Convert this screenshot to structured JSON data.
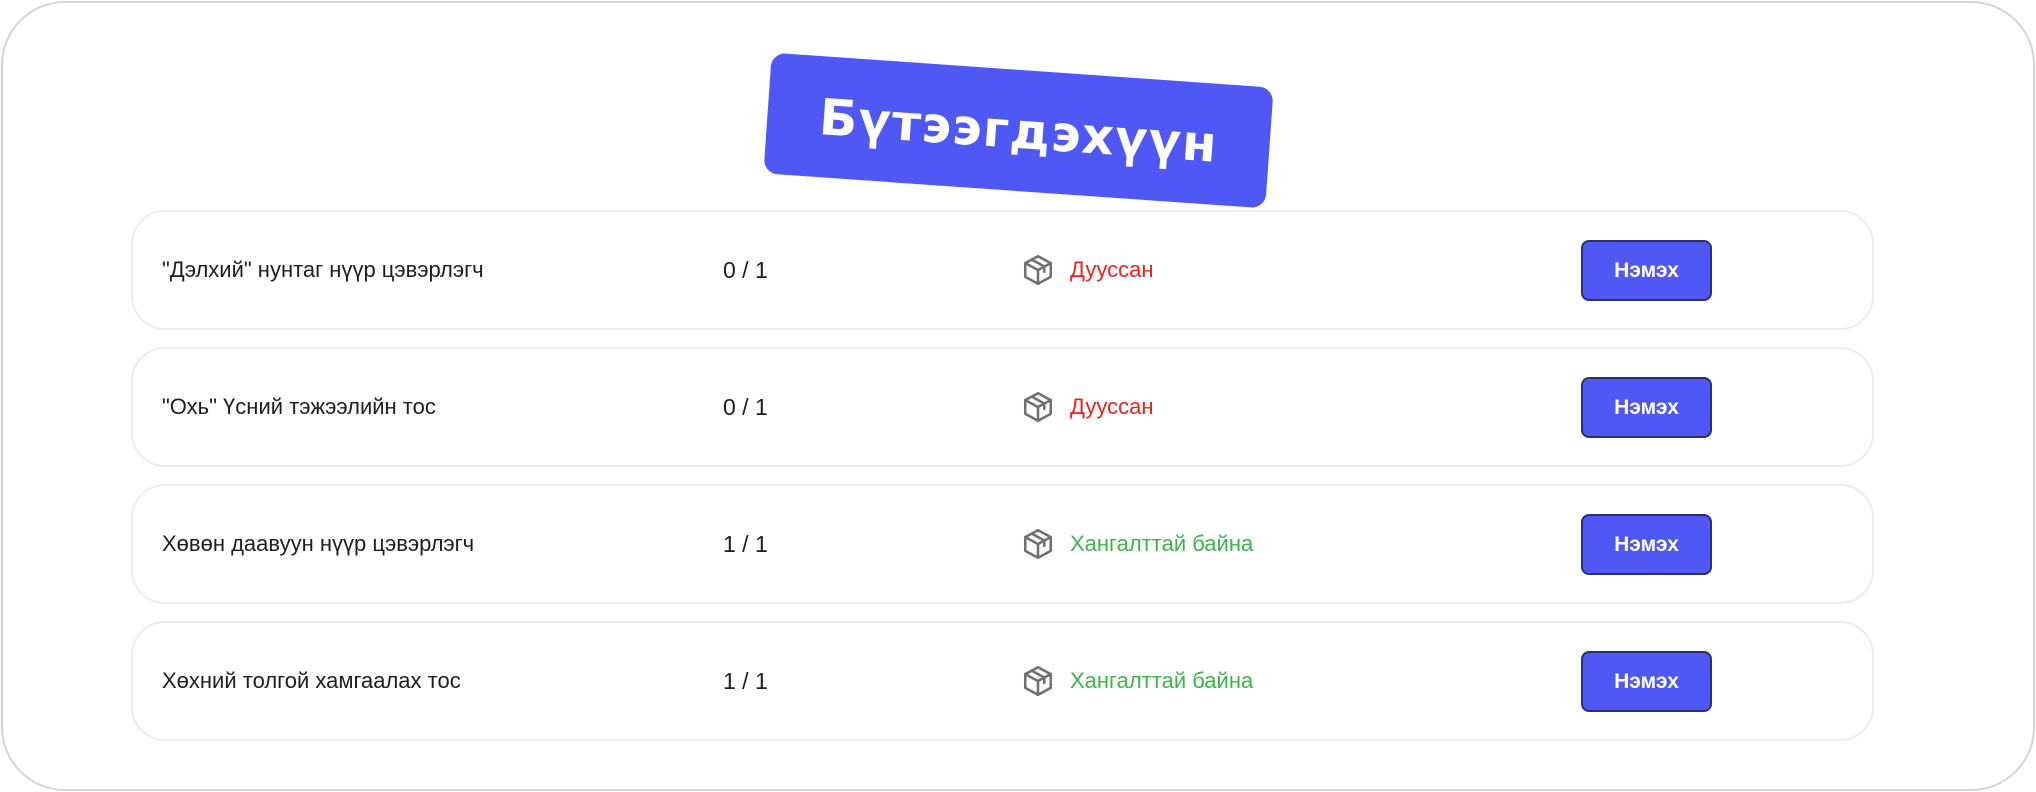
{
  "title": "Бүтээгдэхүүн",
  "colors": {
    "accent": "#4f57f4",
    "status_out": "#e6251e",
    "status_ok": "#3db34a"
  },
  "icons": {
    "status": "package-box-icon"
  },
  "products": [
    {
      "name": "\"Дэлхий\" нунтаг нүүр цэвэрлэгч",
      "count": "0 / 1",
      "status": "Дууссан",
      "status_type": "out",
      "button": "Нэмэх"
    },
    {
      "name": "\"Охь\" Үсний тэжээлийн тос",
      "count": "0 / 1",
      "status": "Дууссан",
      "status_type": "out",
      "button": "Нэмэх"
    },
    {
      "name": "Хөвөн даавуун нүүр цэвэрлэгч",
      "count": "1 / 1",
      "status": "Хангалттай байна",
      "status_type": "ok",
      "button": "Нэмэх"
    },
    {
      "name": "Хөхний толгой хамгаалах тос",
      "count": "1 / 1",
      "status": "Хангалттай байна",
      "status_type": "ok",
      "button": "Нэмэх"
    }
  ]
}
